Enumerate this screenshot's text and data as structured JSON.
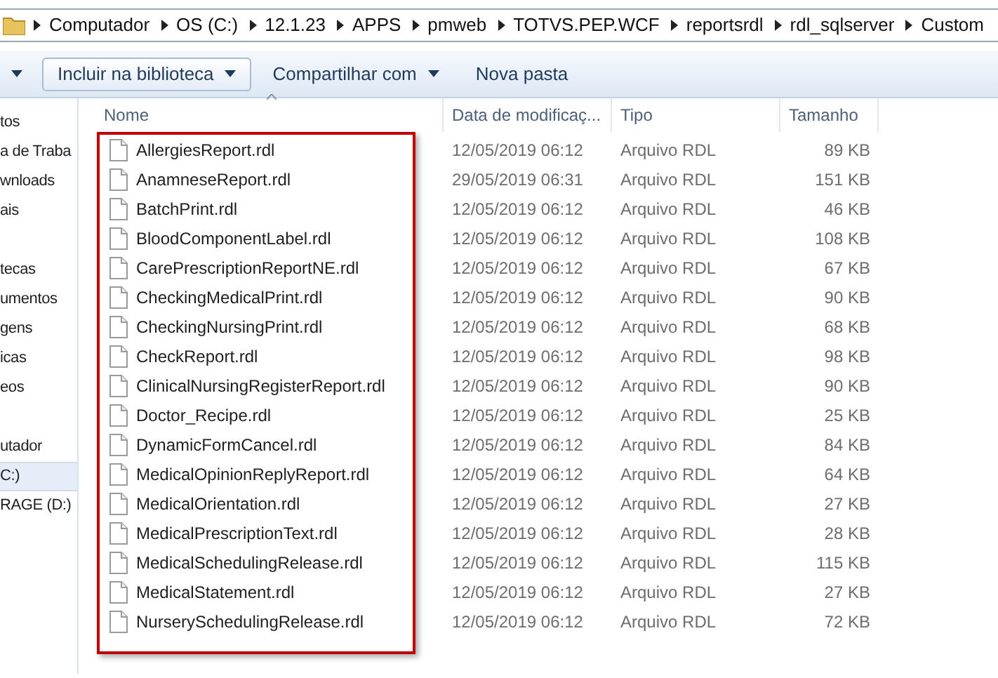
{
  "address_bar": {
    "segments": [
      "Computador",
      "OS (C:)",
      "12.1.23",
      "APPS",
      "pmweb",
      "TOTVS.PEP.WCF",
      "reportsrdl",
      "rdl_sqlserver",
      "Custom"
    ]
  },
  "toolbar": {
    "buttons": [
      {
        "label": "Incluir na biblioteca",
        "dropdown": true,
        "raised": true
      },
      {
        "label": "Compartilhar com",
        "dropdown": true,
        "raised": false
      },
      {
        "label": "Nova pasta",
        "dropdown": false,
        "raised": false
      }
    ]
  },
  "sidebar": {
    "groups": [
      {
        "items": [
          {
            "label": "tos",
            "selected": false
          },
          {
            "label": "a de Traba",
            "selected": false
          },
          {
            "label": "wnloads",
            "selected": false
          },
          {
            "label": "ais",
            "selected": false
          }
        ]
      },
      {
        "items": [
          {
            "label": "tecas",
            "selected": false
          },
          {
            "label": "umentos",
            "selected": false
          },
          {
            "label": "gens",
            "selected": false
          },
          {
            "label": "icas",
            "selected": false
          },
          {
            "label": "eos",
            "selected": false
          }
        ]
      },
      {
        "items": [
          {
            "label": "utador",
            "selected": false
          },
          {
            "label": "C:)",
            "selected": true
          },
          {
            "label": "RAGE (D:)",
            "selected": false
          }
        ]
      }
    ]
  },
  "table": {
    "columns": [
      "Nome",
      "Data de modificaç...",
      "Tipo",
      "Tamanho"
    ],
    "rows": [
      {
        "name": "AllergiesReport.rdl",
        "date": "12/05/2019 06:12",
        "type": "Arquivo RDL",
        "size": "89 KB"
      },
      {
        "name": "AnamneseReport.rdl",
        "date": "29/05/2019 06:31",
        "type": "Arquivo RDL",
        "size": "151 KB"
      },
      {
        "name": "BatchPrint.rdl",
        "date": "12/05/2019 06:12",
        "type": "Arquivo RDL",
        "size": "46 KB"
      },
      {
        "name": "BloodComponentLabel.rdl",
        "date": "12/05/2019 06:12",
        "type": "Arquivo RDL",
        "size": "108 KB"
      },
      {
        "name": "CarePrescriptionReportNE.rdl",
        "date": "12/05/2019 06:12",
        "type": "Arquivo RDL",
        "size": "67 KB"
      },
      {
        "name": "CheckingMedicalPrint.rdl",
        "date": "12/05/2019 06:12",
        "type": "Arquivo RDL",
        "size": "90 KB"
      },
      {
        "name": "CheckingNursingPrint.rdl",
        "date": "12/05/2019 06:12",
        "type": "Arquivo RDL",
        "size": "68 KB"
      },
      {
        "name": "CheckReport.rdl",
        "date": "12/05/2019 06:12",
        "type": "Arquivo RDL",
        "size": "98 KB"
      },
      {
        "name": "ClinicalNursingRegisterReport.rdl",
        "date": "12/05/2019 06:12",
        "type": "Arquivo RDL",
        "size": "90 KB"
      },
      {
        "name": "Doctor_Recipe.rdl",
        "date": "12/05/2019 06:12",
        "type": "Arquivo RDL",
        "size": "25 KB"
      },
      {
        "name": "DynamicFormCancel.rdl",
        "date": "12/05/2019 06:12",
        "type": "Arquivo RDL",
        "size": "84 KB"
      },
      {
        "name": "MedicalOpinionReplyReport.rdl",
        "date": "12/05/2019 06:12",
        "type": "Arquivo RDL",
        "size": "64 KB"
      },
      {
        "name": "MedicalOrientation.rdl",
        "date": "12/05/2019 06:12",
        "type": "Arquivo RDL",
        "size": "27 KB"
      },
      {
        "name": "MedicalPrescriptionText.rdl",
        "date": "12/05/2019 06:12",
        "type": "Arquivo RDL",
        "size": "28 KB"
      },
      {
        "name": "MedicalSchedulingRelease.rdl",
        "date": "12/05/2019 06:12",
        "type": "Arquivo RDL",
        "size": "115 KB"
      },
      {
        "name": "MedicalStatement.rdl",
        "date": "12/05/2019 06:12",
        "type": "Arquivo RDL",
        "size": "27 KB"
      },
      {
        "name": "NurserySchedulingRelease.rdl",
        "date": "12/05/2019 06:12",
        "type": "Arquivo RDL",
        "size": "72 KB"
      }
    ]
  }
}
